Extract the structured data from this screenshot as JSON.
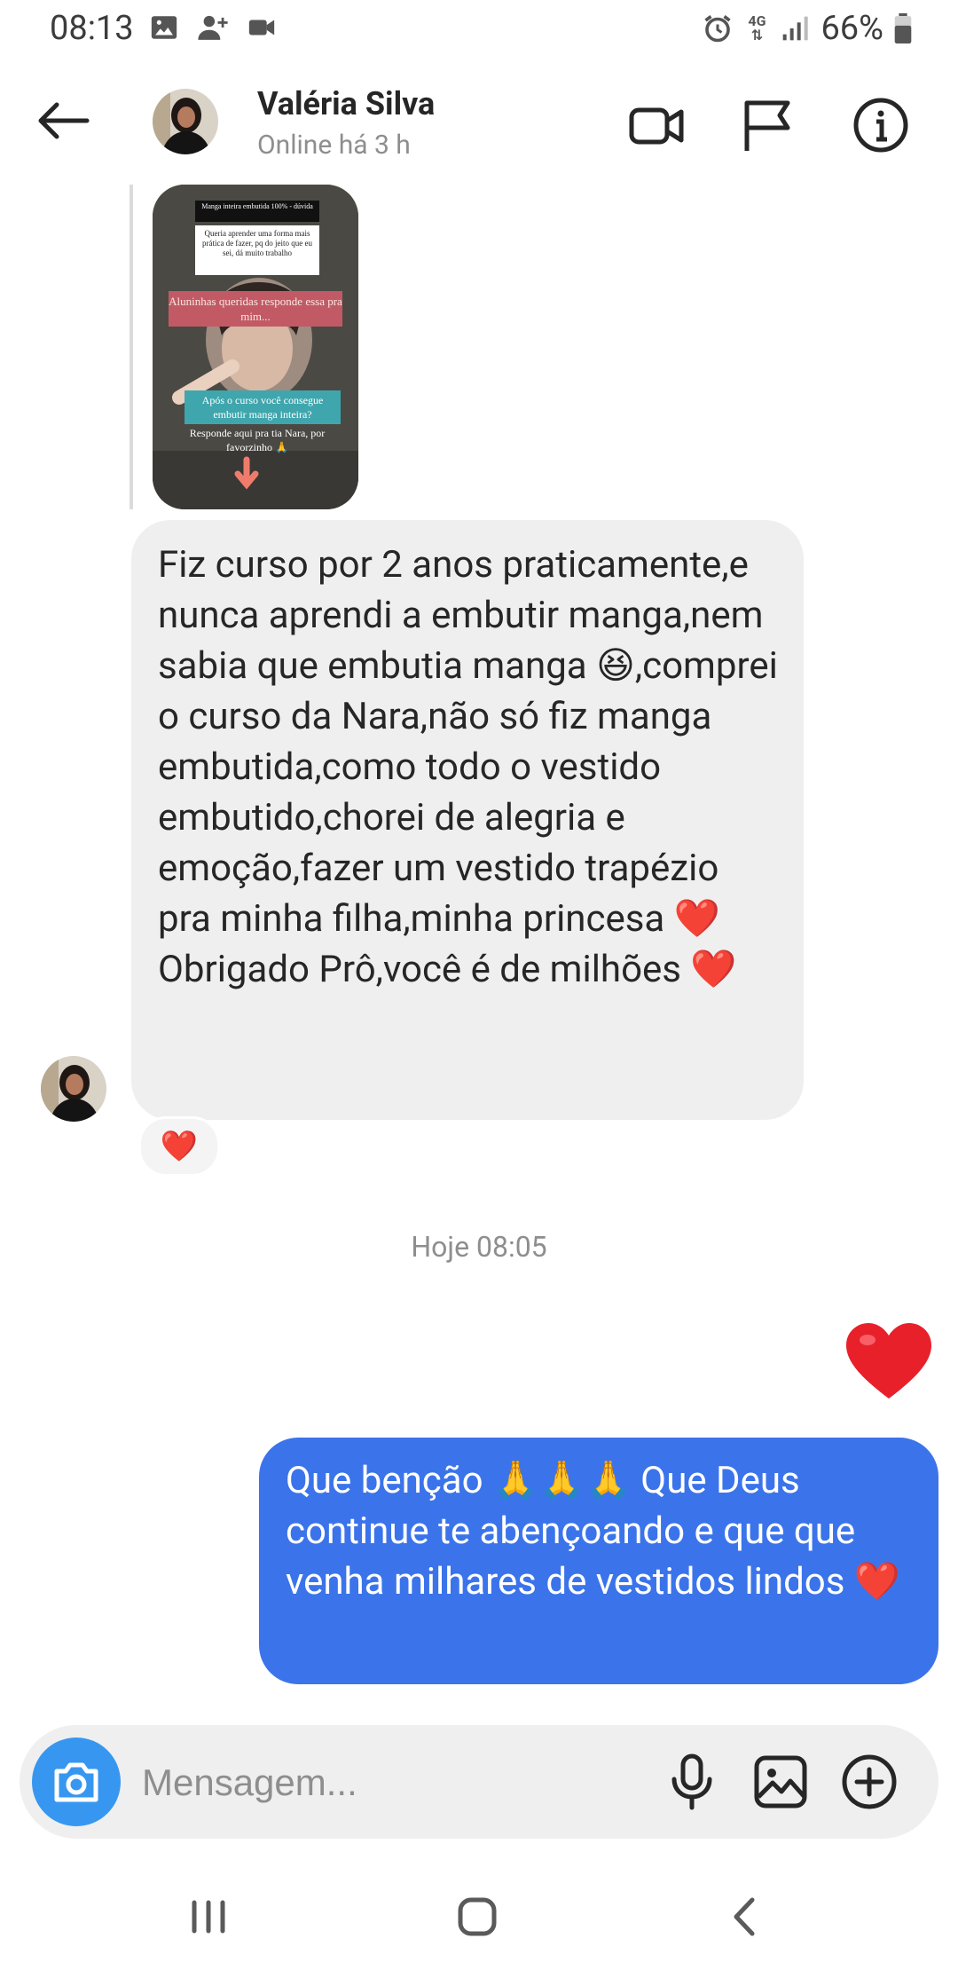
{
  "status_bar": {
    "time": "08:13",
    "battery": "66%",
    "network": "4G",
    "left_icons": [
      "image-icon",
      "person-add-icon",
      "video-icon"
    ],
    "right_icons": [
      "alarm-icon",
      "network-arrows-icon",
      "signal-icon",
      "battery-icon"
    ]
  },
  "header": {
    "name": "Valéria Silva",
    "status": "Online há 3 h",
    "actions": [
      "video-call-icon",
      "flag-icon",
      "info-icon"
    ]
  },
  "story_reply": {
    "top_label": "Manga inteira embutida 100% - dúvida",
    "question": "Queria aprender uma forma mais prática de fazer, pq do jeito que eu sei, dá muito trabalho",
    "pink_banner": "Aluninhas queridas responde essa pra mim...",
    "teal_banner": "Após o curso você consegue embutir manga inteira?",
    "caption": "Responde aqui pra tia Nara, por favorzinho 🙏"
  },
  "messages": {
    "incoming": "Fiz curso por 2 anos praticamente,e nunca aprendi a embutir manga,nem sabia que embutia manga 😆,comprei o curso da Nara,não só fiz manga embutida,como todo o vestido embutido,chorei de alegria e emoção,fazer um vestido trapézio pra minha filha,minha princesa ❤️ Obrigado Prô,você é de milhões ❤️",
    "reaction": "❤️",
    "timestamp": "Hoje 08:05",
    "outgoing_heart": "❤️",
    "outgoing": "Que benção 🙏🙏🙏 Que Deus continue te abençoando e que que venha milhares de vestidos lindos ❤️"
  },
  "composer": {
    "placeholder": "Mensagem..."
  },
  "colors": {
    "outgoing_bubble": "#3b74ea",
    "incoming_bubble": "#efefef",
    "camera_button": "#3797f0",
    "heart": "#e8202a"
  }
}
